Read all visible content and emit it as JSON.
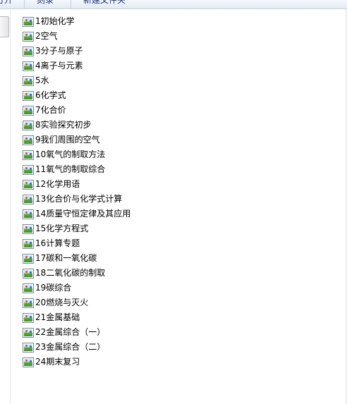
{
  "toolbar": {
    "items": [
      {
        "label": "打开"
      },
      {
        "label": "刻录"
      },
      {
        "label": "新建文件夹"
      }
    ]
  },
  "files": [
    {
      "name": "1初始化学",
      "icon": "image-file-icon"
    },
    {
      "name": "2空气",
      "icon": "image-file-icon"
    },
    {
      "name": "3分子与原子",
      "icon": "image-file-icon"
    },
    {
      "name": "4离子与元素",
      "icon": "image-file-icon"
    },
    {
      "name": "5水",
      "icon": "image-file-icon"
    },
    {
      "name": "6化学式",
      "icon": "image-file-icon"
    },
    {
      "name": "7化合价",
      "icon": "image-file-icon"
    },
    {
      "name": "8实验探究初步",
      "icon": "image-file-icon"
    },
    {
      "name": "9我们周围的空气",
      "icon": "image-file-icon"
    },
    {
      "name": "10氧气的制取方法",
      "icon": "image-file-icon"
    },
    {
      "name": "11氧气的制取综合",
      "icon": "image-file-icon"
    },
    {
      "name": "12化学用语",
      "icon": "image-file-icon"
    },
    {
      "name": "13化合价与化学式计算",
      "icon": "image-file-icon"
    },
    {
      "name": "14质量守恒定律及其应用",
      "icon": "image-file-icon"
    },
    {
      "name": "15化学方程式",
      "icon": "image-file-icon"
    },
    {
      "name": "16计算专题",
      "icon": "image-file-icon"
    },
    {
      "name": "17碳和一氧化碳",
      "icon": "image-file-icon"
    },
    {
      "name": "18二氧化碳的制取",
      "icon": "image-file-icon"
    },
    {
      "name": "19碳综合",
      "icon": "image-file-icon"
    },
    {
      "name": "20燃烧与灭火",
      "icon": "image-file-icon"
    },
    {
      "name": "21金属基础",
      "icon": "image-file-icon"
    },
    {
      "name": "22金属综合（一）",
      "icon": "image-file-icon"
    },
    {
      "name": "23金属综合（二）",
      "icon": "image-file-icon"
    },
    {
      "name": "24期末复习",
      "icon": "image-file-icon"
    }
  ]
}
